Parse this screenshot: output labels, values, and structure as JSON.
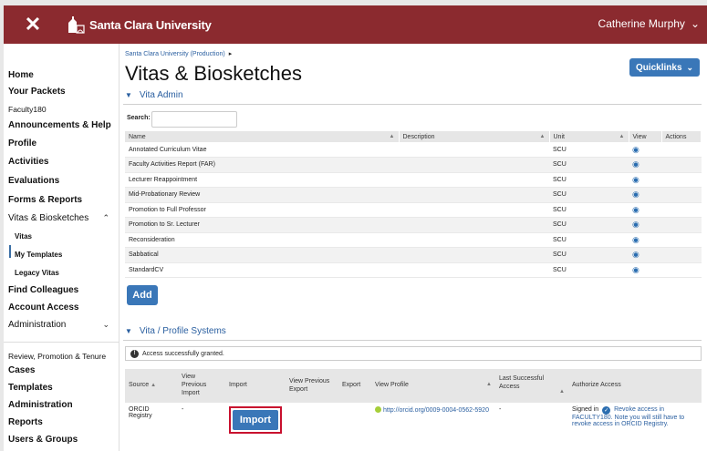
{
  "header": {
    "university": "Santa Clara University",
    "user_name": "Catherine Murphy"
  },
  "sidebar": {
    "home": "Home",
    "your_packets": "Your Packets",
    "faculty180": "Faculty180",
    "announcements": "Announcements & Help",
    "profile": "Profile",
    "activities": "Activities",
    "evaluations": "Evaluations",
    "forms_reports": "Forms & Reports",
    "vitas_biosketches": "Vitas & Biosketches",
    "vitas": "Vitas",
    "my_templates": "My Templates",
    "legacy_vitas": "Legacy Vitas",
    "find_colleagues": "Find Colleagues",
    "account_access": "Account Access",
    "administration": "Administration",
    "rpt": "Review, Promotion & Tenure",
    "cases": "Cases",
    "templates": "Templates",
    "administration2": "Administration",
    "reports": "Reports",
    "users_groups": "Users & Groups"
  },
  "main": {
    "breadcrumb": "Santa Clara University (Production)",
    "title": "Vitas & Biosketches",
    "quicklinks": "Quicklinks",
    "vita_admin_heading": "Vita Admin",
    "search_label": "Search:",
    "search_value": "",
    "columns": [
      "Name",
      "Description",
      "Unit",
      "View",
      "Actions"
    ],
    "rows": [
      {
        "name": "Annotated Curriculum Vitae",
        "description": "",
        "unit": "SCU"
      },
      {
        "name": "Faculty Activities Report (FAR)",
        "description": "",
        "unit": "SCU"
      },
      {
        "name": "Lecturer Reappointment",
        "description": "",
        "unit": "SCU"
      },
      {
        "name": "Mid-Probationary Review",
        "description": "",
        "unit": "SCU"
      },
      {
        "name": "Promotion to Full Professor",
        "description": "",
        "unit": "SCU"
      },
      {
        "name": "Promotion to Sr. Lecturer",
        "description": "",
        "unit": "SCU"
      },
      {
        "name": "Reconsideration",
        "description": "",
        "unit": "SCU"
      },
      {
        "name": "Sabbatical",
        "description": "",
        "unit": "SCU"
      },
      {
        "name": "StandardCV",
        "description": "",
        "unit": "SCU"
      }
    ],
    "add_label": "Add",
    "systems_heading": "Vita / Profile Systems",
    "alert_text": "Access successfully granted.",
    "sys_columns": {
      "source": "Source",
      "view_prev_import": "View Previous Import",
      "import": "Import",
      "view_prev_export": "View Previous Export",
      "export": "Export",
      "view_profile": "View Profile",
      "last_access": "Last Successful Access",
      "authorize": "Authorize Access"
    },
    "sys_row": {
      "source": "ORCID Registry",
      "view_prev_import": "-",
      "import_label": "Import",
      "view_prev_export": "",
      "export": "",
      "profile_url": "http://orcid.org/0009-0004-0562-5920",
      "last_access": "-",
      "signed_in": "Signed in",
      "revoke_text": "Revoke access in FACULTY180. Note you will still have to revoke access in ORCID Registry."
    }
  },
  "colors": {
    "brand": "#8b2a2f",
    "accent": "#3a77b8",
    "highlight": "#c8102e"
  }
}
